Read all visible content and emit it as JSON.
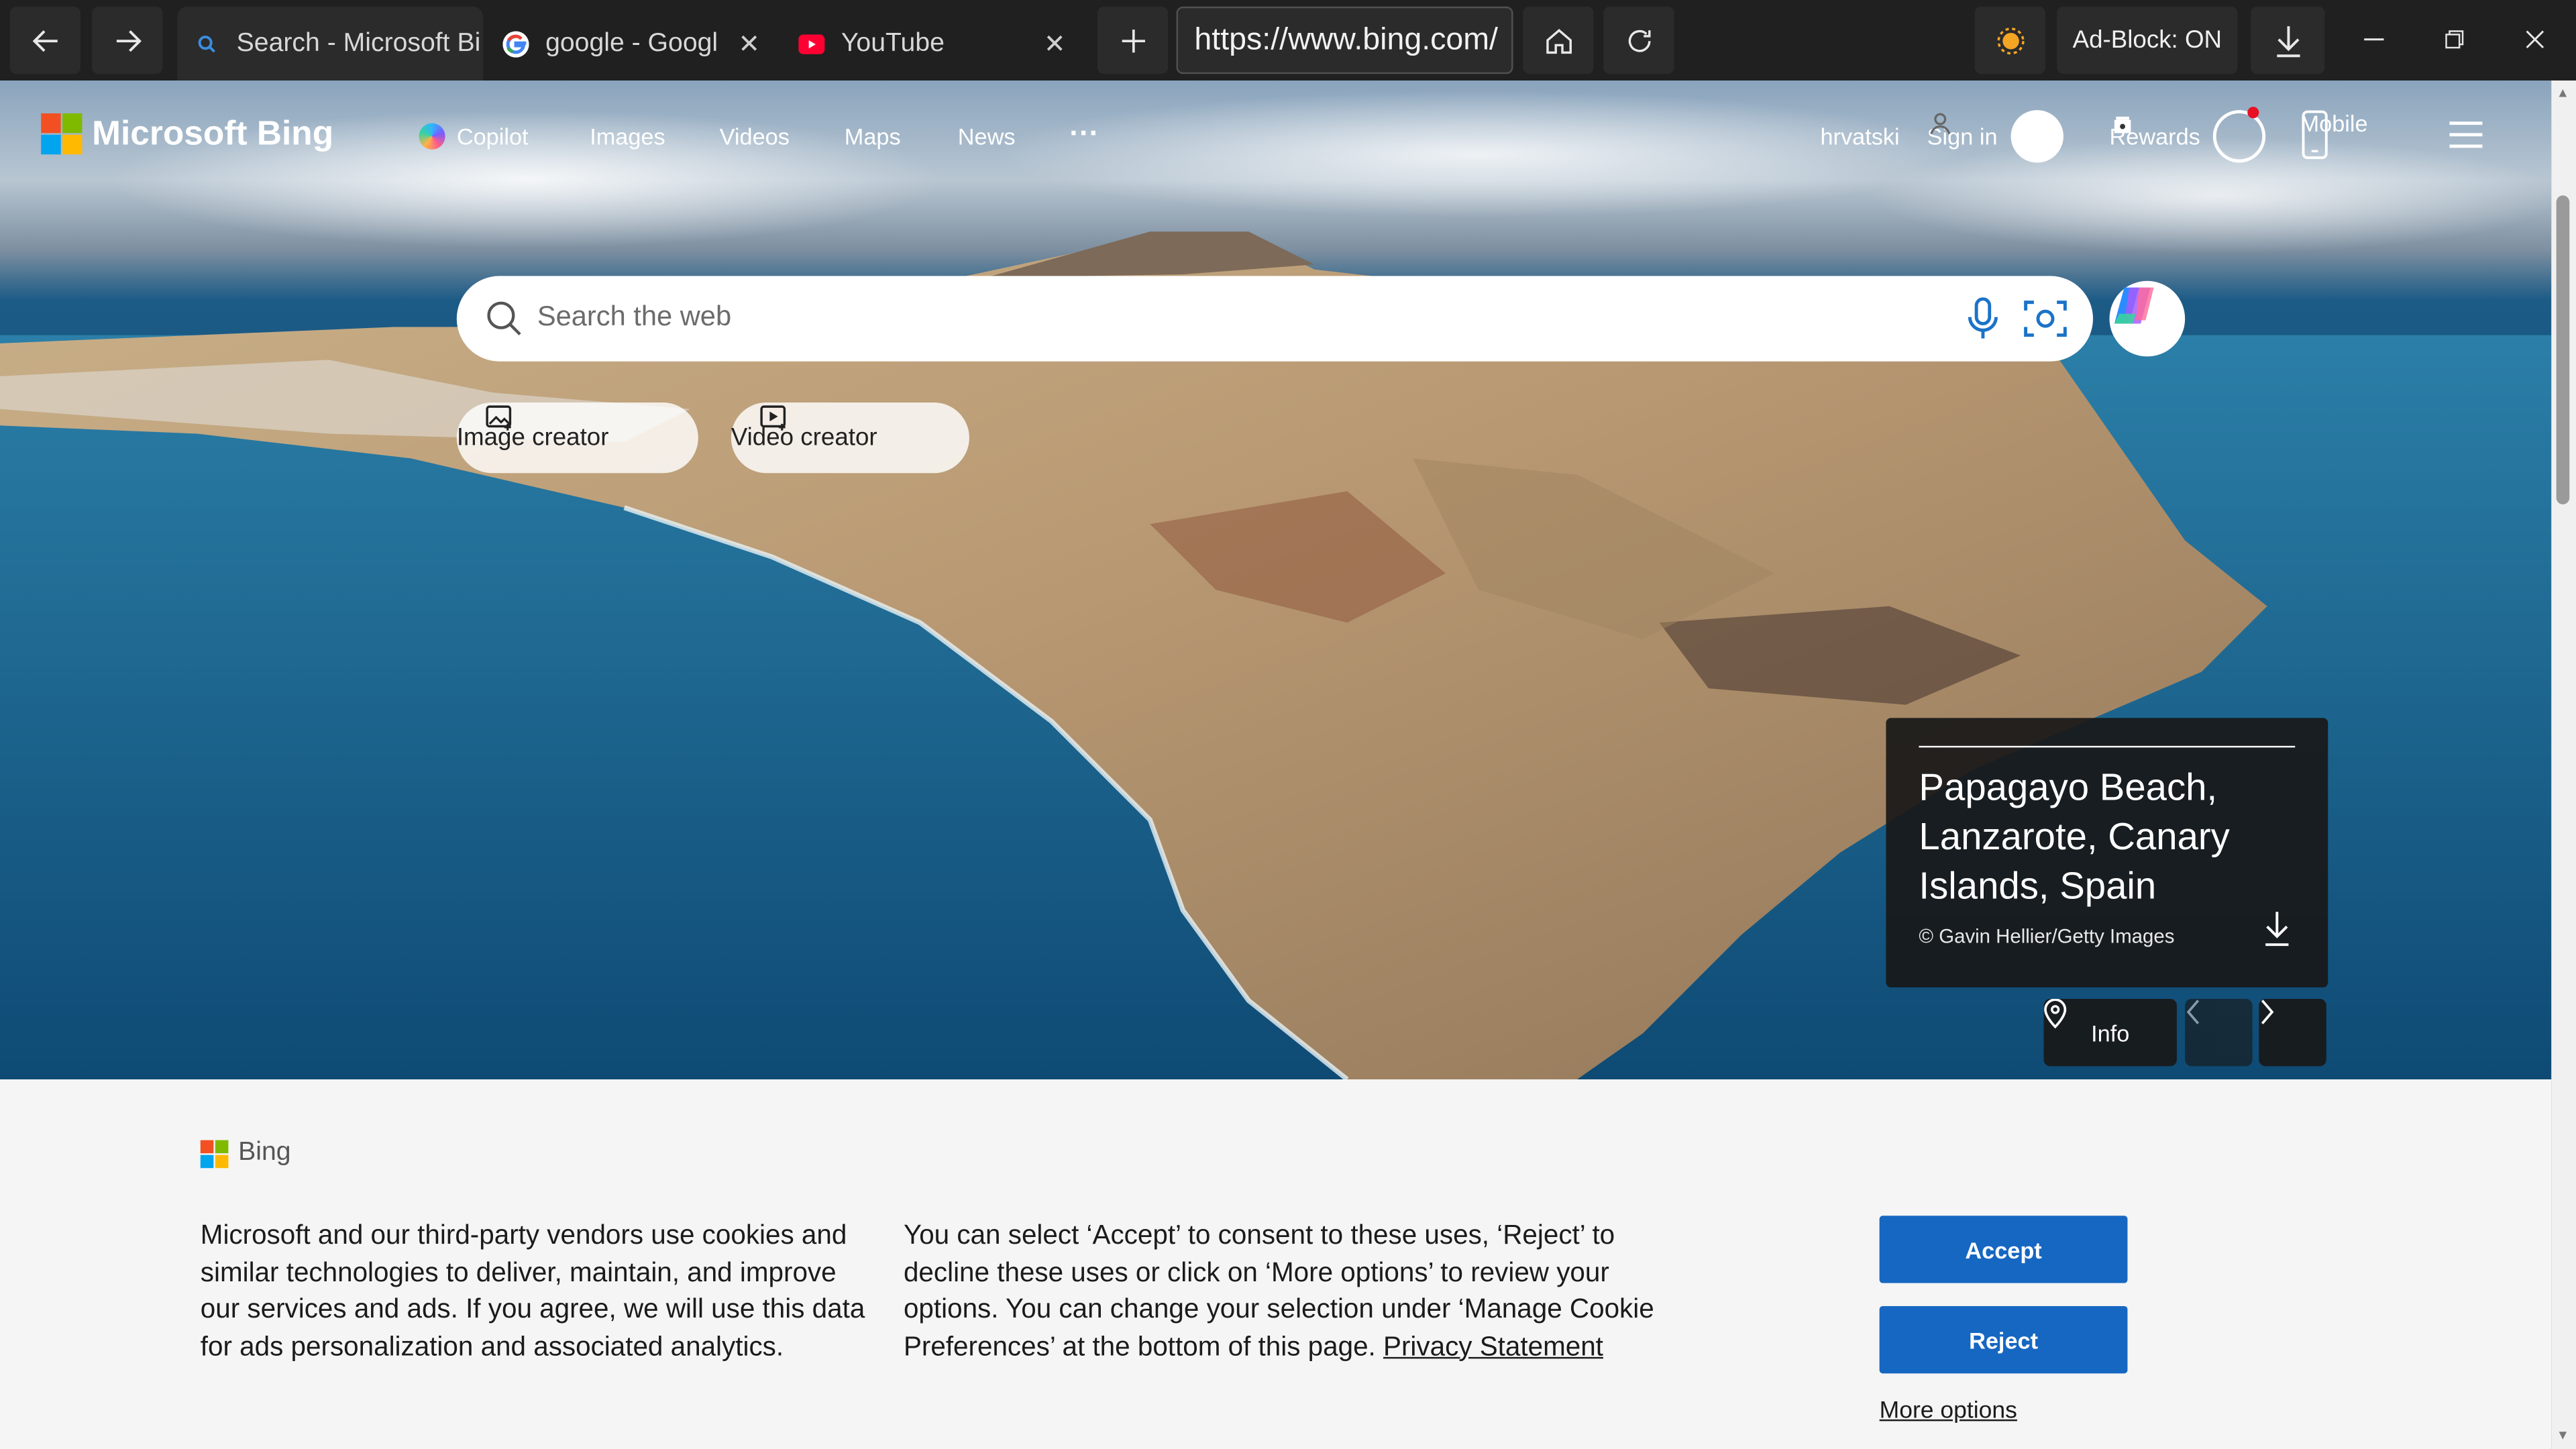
{
  "browser": {
    "tabs": [
      {
        "title": "Search - Microsoft Bi",
        "favicon": "bing-search-favicon",
        "active": true
      },
      {
        "title": "google - Googl",
        "favicon": "google-favicon",
        "active": false
      },
      {
        "title": "YouTube",
        "favicon": "youtube-favicon",
        "active": false
      }
    ],
    "url": "https://www.bing.com/",
    "adblock_label": "Ad-Block: ON"
  },
  "header": {
    "brand": "Microsoft Bing",
    "nav": [
      "Copilot",
      "Images",
      "Videos",
      "Maps",
      "News"
    ],
    "more": "···",
    "language": "hrvatski",
    "sign_in": "Sign in",
    "rewards": "Rewards",
    "mobile": "Mobile"
  },
  "search": {
    "placeholder": "Search the web"
  },
  "actions": {
    "image_creator": "Image creator",
    "video_creator": "Video creator"
  },
  "image_info": {
    "location": "Papagayo Beach, Lanzarote, Canary Islands, Spain",
    "credit": "© Gavin Hellier/Getty Images",
    "info_label": "Info"
  },
  "cookie": {
    "brand": "Bing",
    "text_left": "Microsoft and our third-party vendors use cookies and similar technologies to deliver, maintain, and improve our services and ads. If you agree, we will use this data for ads personalization and associated analytics.",
    "text_right": "You can select ‘Accept’ to consent to these uses, ‘Reject’ to decline these uses or click on ‘More options’ to review your options. You can change your selection under ‘Manage Cookie Preferences’ at the bottom of this page.",
    "privacy_link": "Privacy Statement",
    "accept": "Accept",
    "reject": "Reject",
    "more_options": "More options"
  },
  "colors": {
    "accent_button": "#1667c1",
    "chrome_bg": "#202020",
    "cookie_bg": "#f5f5f5"
  }
}
